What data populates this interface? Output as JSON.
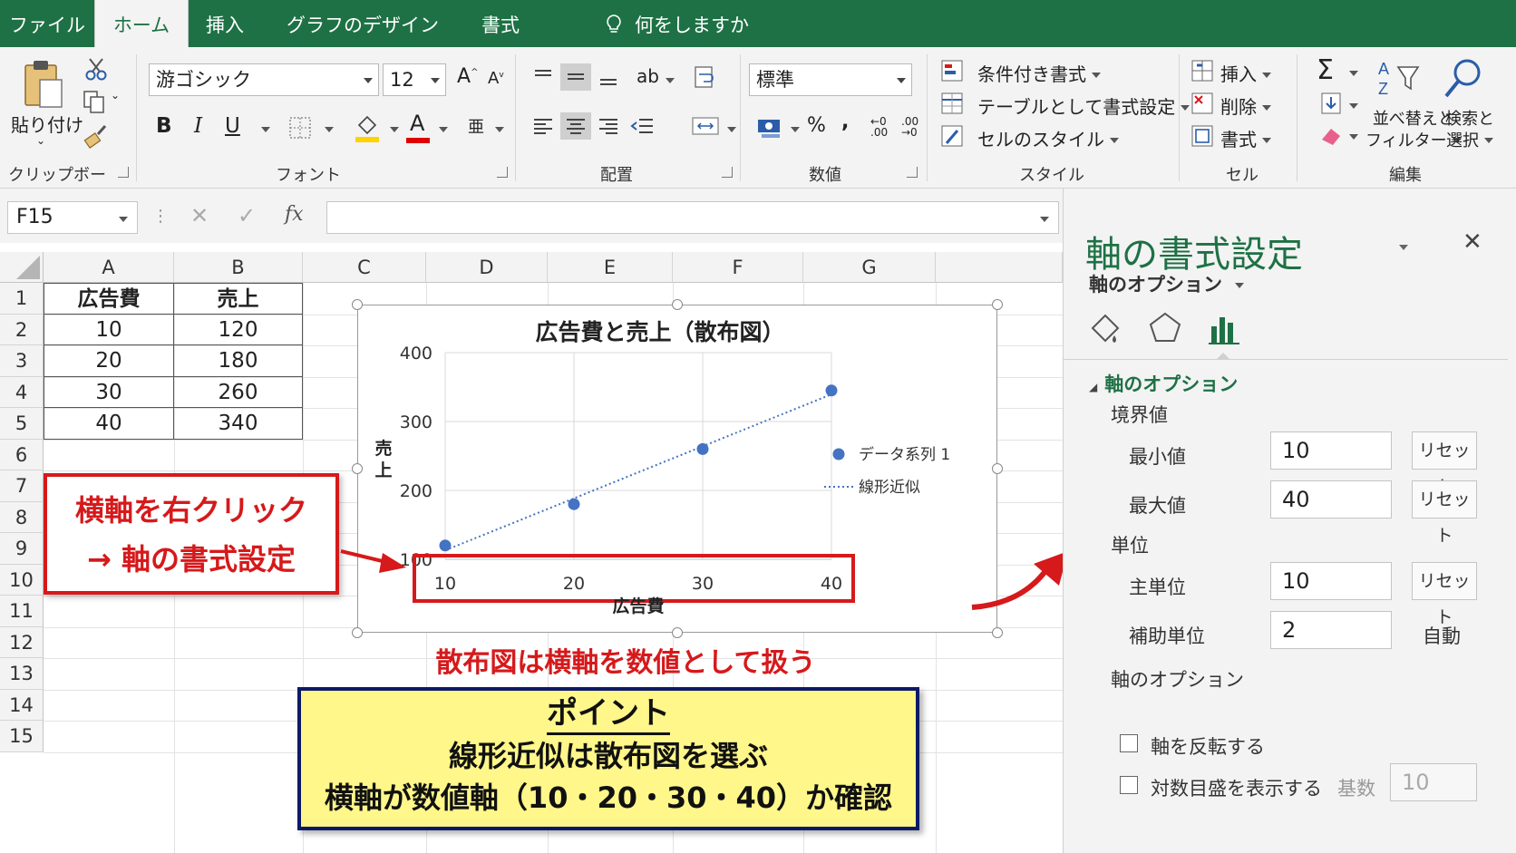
{
  "tabs": [
    "ファイル",
    "ホーム",
    "挿入",
    "グラフのデザイン",
    "書式"
  ],
  "active_tab": "ホーム",
  "tell_me": "何をしますか",
  "ribbon": {
    "clipboard": {
      "paste": "貼り付け",
      "label": "クリップボード"
    },
    "font": {
      "name": "游ゴシック",
      "size": "12",
      "label": "フォント"
    },
    "alignment": {
      "label": "配置"
    },
    "number": {
      "format": "標準",
      "percent": "%",
      "comma": ",",
      "label": "数値"
    },
    "styles": {
      "conditional": "条件付き書式",
      "as_table": "テーブルとして書式設定",
      "cell_styles": "セルのスタイル",
      "label": "スタイル"
    },
    "cells": {
      "insert": "挿入",
      "delete": "削除",
      "format": "書式",
      "label": "セル"
    },
    "editing": {
      "sort_line1": "並べ替えと",
      "sort_line2": "フィルター",
      "find_line1": "検索と",
      "find_line2": "選択",
      "label": "編集"
    }
  },
  "formula_bar": {
    "name_box": "F15",
    "fx": "fx",
    "value": ""
  },
  "sheet": {
    "columns": [
      "A",
      "B",
      "C",
      "D",
      "E",
      "F",
      "G"
    ],
    "rows": [
      "1",
      "2",
      "3",
      "4",
      "5",
      "6",
      "7",
      "8",
      "9",
      "10",
      "11",
      "12",
      "13",
      "14",
      "15"
    ],
    "table": {
      "headers": [
        "広告費",
        "売上"
      ],
      "rows": [
        [
          "10",
          "120"
        ],
        [
          "20",
          "180"
        ],
        [
          "30",
          "260"
        ],
        [
          "40",
          "340"
        ]
      ]
    }
  },
  "chart_data": {
    "type": "scatter",
    "title": "広告費と売上（散布図）",
    "xlabel": "広告費",
    "ylabel": "売上",
    "x": [
      10,
      20,
      30,
      40
    ],
    "series": [
      {
        "name": "データ系列 1",
        "values": [
          120,
          180,
          260,
          345
        ]
      }
    ],
    "trendline": {
      "name": "線形近似",
      "type": "linear"
    },
    "x_ticks": [
      "10",
      "20",
      "30",
      "40"
    ],
    "y_ticks": [
      "100",
      "200",
      "300",
      "400"
    ],
    "xlim": [
      10,
      40
    ],
    "ylim": [
      100,
      400
    ],
    "grid": true,
    "legend_position": "right",
    "colors": {
      "series": "#4472c4",
      "highlight": "#d6191b"
    }
  },
  "annotations": {
    "callout_line1": "横軸を右クリック",
    "callout_line2": "→ 軸の書式設定",
    "scatter_note": "散布図は横軸を数値として扱う",
    "point_title": "ポイント",
    "point_line1": "線形近似は散布図を選ぶ",
    "point_line2": "横軸が数値軸（10・20・30・40）か確認"
  },
  "pane": {
    "title": "軸の書式設定",
    "options_dropdown": "軸のオプション",
    "section": "軸のオプション",
    "bounds": "境界値",
    "min_label": "最小値",
    "min_value": "10",
    "max_label": "最大値",
    "max_value": "40",
    "reset": "リセット",
    "units": "単位",
    "major_label": "主単位",
    "major_value": "10",
    "minor_label": "補助単位",
    "minor_value": "2",
    "auto": "自動",
    "axis_options": "軸のオプション",
    "reverse": "軸を反転する",
    "log_scale": "対数目盛を表示する",
    "base_label": "基数",
    "base_value": "10"
  },
  "colors": {
    "excel_green": "#1e7145",
    "ribbon_bg": "#f3f3f3",
    "red": "#d6191b",
    "yellow": "#fff78a",
    "navy": "#0d1a66"
  }
}
